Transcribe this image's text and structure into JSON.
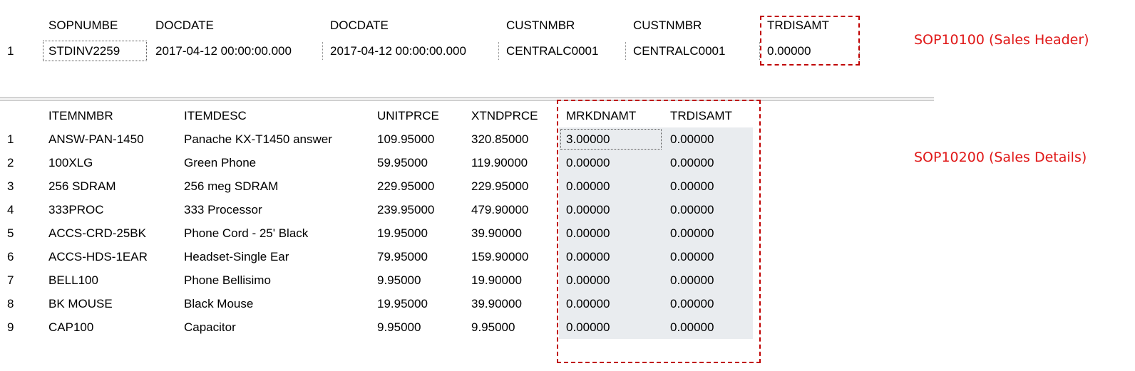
{
  "header_table": {
    "columns": [
      "SOPNUMBE",
      "DOCDATE",
      "DOCDATE",
      "CUSTNMBR",
      "CUSTNMBR",
      "TRDISAMT"
    ],
    "rows": [
      [
        "1",
        "STDINV2259",
        "2017-04-12 00:00:00.000",
        "2017-04-12 00:00:00.000",
        "CENTRALC0001",
        "CENTRALC0001",
        "0.00000"
      ]
    ]
  },
  "detail_table": {
    "columns": [
      "ITEMNMBR",
      "ITEMDESC",
      "UNITPRCE",
      "XTNDPRCE",
      "MRKDNAMT",
      "TRDISAMT"
    ],
    "rows": [
      [
        "1",
        "ANSW-PAN-1450",
        "Panache KX-T1450 answer",
        "109.95000",
        "320.85000",
        "3.00000",
        "0.00000"
      ],
      [
        "2",
        "100XLG",
        "Green Phone",
        "59.95000",
        "119.90000",
        "0.00000",
        "0.00000"
      ],
      [
        "3",
        "256 SDRAM",
        "256 meg SDRAM",
        "229.95000",
        "229.95000",
        "0.00000",
        "0.00000"
      ],
      [
        "4",
        "333PROC",
        "333 Processor",
        "239.95000",
        "479.90000",
        "0.00000",
        "0.00000"
      ],
      [
        "5",
        "ACCS-CRD-25BK",
        "Phone Cord - 25' Black",
        "19.95000",
        "39.90000",
        "0.00000",
        "0.00000"
      ],
      [
        "6",
        "ACCS-HDS-1EAR",
        "Headset-Single Ear",
        "79.95000",
        "159.90000",
        "0.00000",
        "0.00000"
      ],
      [
        "7",
        "BELL100",
        "Phone Bellisimo",
        "9.95000",
        "19.90000",
        "0.00000",
        "0.00000"
      ],
      [
        "8",
        "BK MOUSE",
        "Black Mouse",
        "19.95000",
        "39.90000",
        "0.00000",
        "0.00000"
      ],
      [
        "9",
        "CAP100",
        "Capacitor",
        "9.95000",
        "9.95000",
        "0.00000",
        "0.00000"
      ]
    ]
  },
  "annotations": {
    "header_label": "SOP10100 (Sales Header)",
    "detail_label": "SOP10200 (Sales Details)"
  },
  "colors": {
    "highlight": "#c00000",
    "annotation_text": "#e01818",
    "shaded_cell": "#e9ecef"
  }
}
